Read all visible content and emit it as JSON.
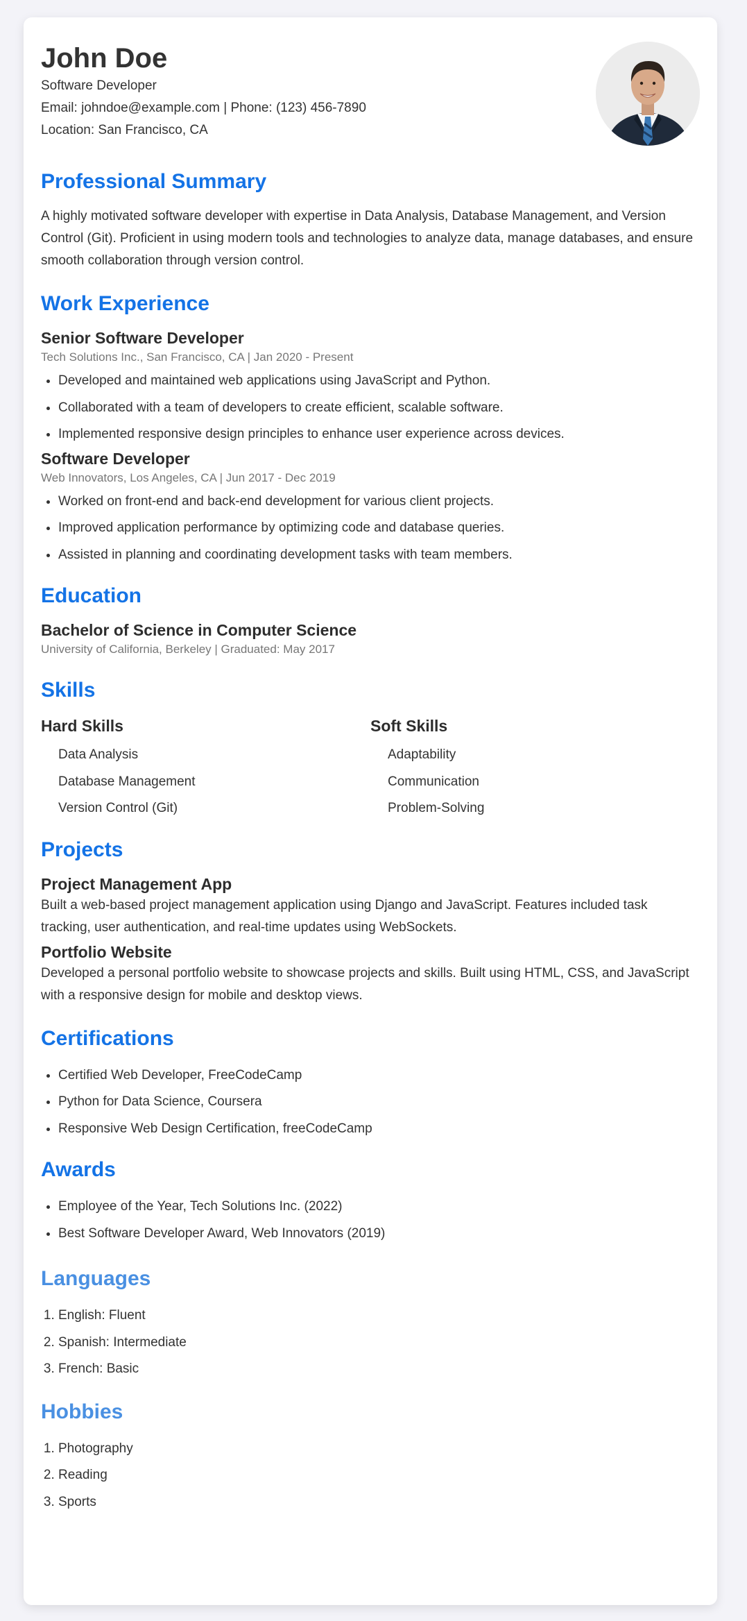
{
  "header": {
    "name": "John Doe",
    "title": "Software Developer",
    "contact": "Email: johndoe@example.com | Phone: (123) 456-7890",
    "location": "Location: San Francisco, CA"
  },
  "summary": {
    "heading": "Professional Summary",
    "text": "A highly motivated software developer with expertise in Data Analysis, Database Management, and Version Control (Git). Proficient in using modern tools and technologies to analyze data, manage databases, and ensure smooth collaboration through version control."
  },
  "experience": {
    "heading": "Work Experience",
    "jobs": [
      {
        "title": "Senior Software Developer",
        "meta": "Tech Solutions Inc., San Francisco, CA | Jan 2020 - Present",
        "bullets": [
          "Developed and maintained web applications using JavaScript and Python.",
          "Collaborated with a team of developers to create efficient, scalable software.",
          "Implemented responsive design principles to enhance user experience across devices."
        ]
      },
      {
        "title": "Software Developer",
        "meta": "Web Innovators, Los Angeles, CA | Jun 2017 - Dec 2019",
        "bullets": [
          "Worked on front-end and back-end development for various client projects.",
          "Improved application performance by optimizing code and database queries.",
          "Assisted in planning and coordinating development tasks with team members."
        ]
      }
    ]
  },
  "education": {
    "heading": "Education",
    "degree": "Bachelor of Science in Computer Science",
    "meta": "University of California, Berkeley | Graduated: May 2017"
  },
  "skills": {
    "heading": "Skills",
    "hard": {
      "heading": "Hard Skills",
      "items": [
        "Data Analysis",
        "Database Management",
        "Version Control (Git)"
      ]
    },
    "soft": {
      "heading": "Soft Skills",
      "items": [
        "Adaptability",
        "Communication",
        "Problem-Solving"
      ]
    }
  },
  "projects": {
    "heading": "Projects",
    "items": [
      {
        "title": "Project Management App",
        "desc": "Built a web-based project management application using Django and JavaScript. Features included task tracking, user authentication, and real-time updates using WebSockets."
      },
      {
        "title": "Portfolio Website",
        "desc": "Developed a personal portfolio website to showcase projects and skills. Built using HTML, CSS, and JavaScript with a responsive design for mobile and desktop views."
      }
    ]
  },
  "certifications": {
    "heading": "Certifications",
    "items": [
      "Certified Web Developer, FreeCodeCamp",
      "Python for Data Science, Coursera",
      "Responsive Web Design Certification, freeCodeCamp"
    ]
  },
  "awards": {
    "heading": "Awards",
    "items": [
      "Employee of the Year, Tech Solutions Inc. (2022)",
      "Best Software Developer Award, Web Innovators (2019)"
    ]
  },
  "languages": {
    "heading": "Languages",
    "items": [
      "English: Fluent",
      "Spanish: Intermediate",
      "French: Basic"
    ]
  },
  "hobbies": {
    "heading": "Hobbies",
    "items": [
      "Photography",
      "Reading",
      "Sports"
    ]
  },
  "colors": {
    "heading_blue": "#1473e6",
    "heading_light_blue": "#4a90e2",
    "page_background": "#f3f3f8",
    "card_background": "#ffffff",
    "meta_gray": "#777777"
  },
  "icons": {
    "avatar": "profile-photo"
  }
}
